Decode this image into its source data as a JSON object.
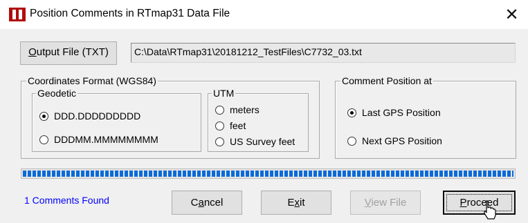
{
  "window": {
    "title": "Position Comments in RTmap31 Data File",
    "close_glyph": "✕"
  },
  "output": {
    "button_prefix": "",
    "button_mnemonic": "O",
    "button_rest": "utput File (TXT)",
    "path": "C:\\Data\\RTmap31\\20181212_TestFiles\\C7732_03.txt"
  },
  "coordinates": {
    "legend": "Coordinates Format (WGS84)",
    "geodetic": {
      "legend": "Geodetic",
      "options": [
        {
          "label": "DDD.DDDDDDDDD",
          "selected": true
        },
        {
          "label": "DDDMM.MMMMMMMM",
          "selected": false
        }
      ]
    },
    "utm": {
      "legend": "UTM",
      "options": [
        {
          "label": "meters",
          "selected": false
        },
        {
          "label": "feet",
          "selected": false
        },
        {
          "label": "US Survey feet",
          "selected": false
        }
      ]
    }
  },
  "comment_position": {
    "legend": "Comment Position at",
    "options": [
      {
        "label": "Last GPS Position",
        "selected": true
      },
      {
        "label": "Next GPS Position",
        "selected": false
      }
    ]
  },
  "progress": {
    "fraction": 1.0,
    "color": "#0a6ad8"
  },
  "status": {
    "text": "1 Comments Found",
    "color": "#0000ff"
  },
  "buttons": {
    "cancel": {
      "pre": "C",
      "mn": "a",
      "post": "ncel"
    },
    "exit": {
      "pre": "E",
      "mn": "x",
      "post": "it"
    },
    "view_file": {
      "pre": "",
      "mn": "V",
      "post": "iew File",
      "enabled": false
    },
    "proceed": {
      "pre": "",
      "mn": "P",
      "post": "roceed",
      "default": true
    }
  }
}
